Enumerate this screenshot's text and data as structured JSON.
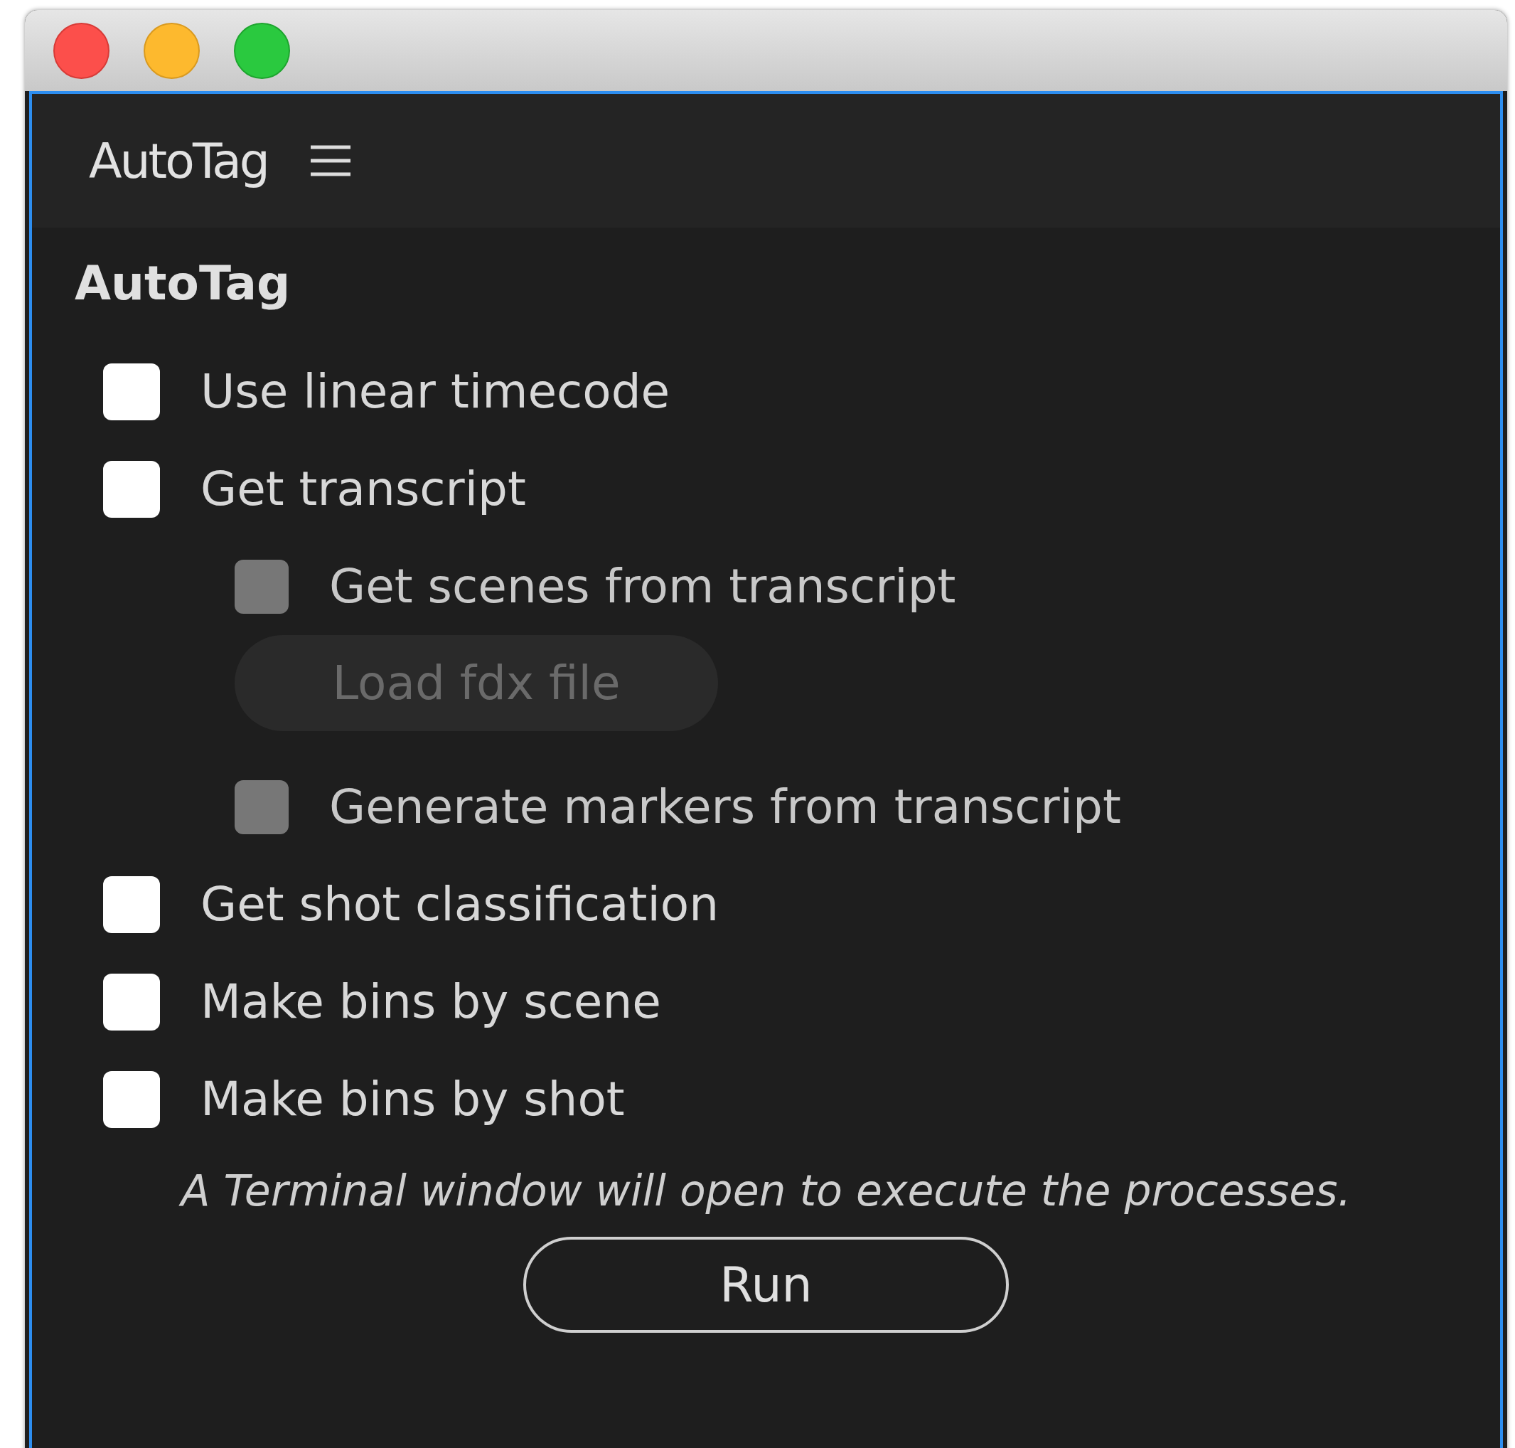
{
  "header": {
    "title": "AutoTag"
  },
  "panel": {
    "title": "AutoTag",
    "options": [
      {
        "kind": "checkbox",
        "label": "Use linear timecode",
        "checked": false,
        "disabled": false
      },
      {
        "kind": "checkbox",
        "label": "Get transcript",
        "checked": false,
        "disabled": false,
        "children": [
          {
            "kind": "checkbox",
            "label": "Get scenes from transcript",
            "checked": false,
            "disabled": true
          },
          {
            "kind": "button",
            "label": "Load fdx file",
            "disabled": true
          },
          {
            "kind": "checkbox",
            "label": "Generate markers from transcript",
            "checked": false,
            "disabled": true
          }
        ]
      },
      {
        "kind": "checkbox",
        "label": "Get shot classification",
        "checked": false,
        "disabled": false
      },
      {
        "kind": "checkbox",
        "label": "Make bins by scene",
        "checked": false,
        "disabled": false
      },
      {
        "kind": "checkbox",
        "label": "Make bins by shot",
        "checked": false,
        "disabled": false
      }
    ],
    "note": "A Terminal window will open to execute the processes.",
    "run_button": "Run"
  }
}
